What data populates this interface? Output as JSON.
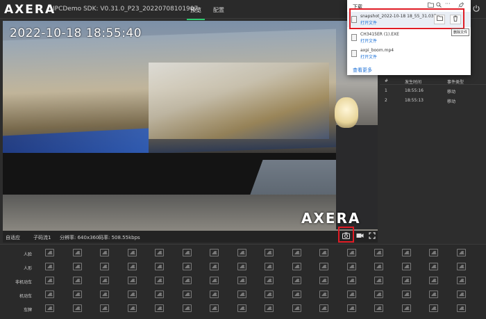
{
  "header": {
    "logo": "AXERA",
    "title": "IPCDemo SDK: V0.31.0_P23_20220708101907",
    "tabs": [
      {
        "label": "预览",
        "active": true
      },
      {
        "label": "配置",
        "active": false
      }
    ],
    "power_icon": "power-icon"
  },
  "video": {
    "timestamp": "2022-10-18 18:55:40",
    "watermark": "AXERA"
  },
  "status": {
    "source": "自适应",
    "stream": "子码流1",
    "resolution": "分辨率: 640x360",
    "bitrate": "码率: 508.55kbps",
    "icons": [
      "camera-icon",
      "record-icon",
      "fullscreen-icon"
    ]
  },
  "events": {
    "headers": [
      "#",
      "发生时间",
      "事件类型"
    ],
    "rows": [
      {
        "id": "1",
        "time": "18:55:16",
        "type": "移动"
      },
      {
        "id": "2",
        "time": "18:55:13",
        "type": "移动"
      }
    ]
  },
  "downloads": {
    "title": "下载",
    "tool_icons": [
      "folder-icon",
      "search-icon",
      "more-icon",
      "pin-icon"
    ],
    "items": [
      {
        "name": "snapshot_2022-10-18 18_55_31.035",
        "action": "打开文件"
      },
      {
        "name": "CH3415ER (1).EXE",
        "action": "打开文件"
      },
      {
        "name": "axpi_boom.mp4",
        "action": "打开文件"
      }
    ],
    "more": "查看更多",
    "tooltip": "删除文件"
  },
  "gallery": {
    "rows": [
      "人脸",
      "人形",
      "非机动车",
      "机动车",
      "车牌"
    ]
  },
  "colors": {
    "accent": "#2ecc71",
    "highlight": "#e01b24",
    "link": "#1a6fd6"
  }
}
